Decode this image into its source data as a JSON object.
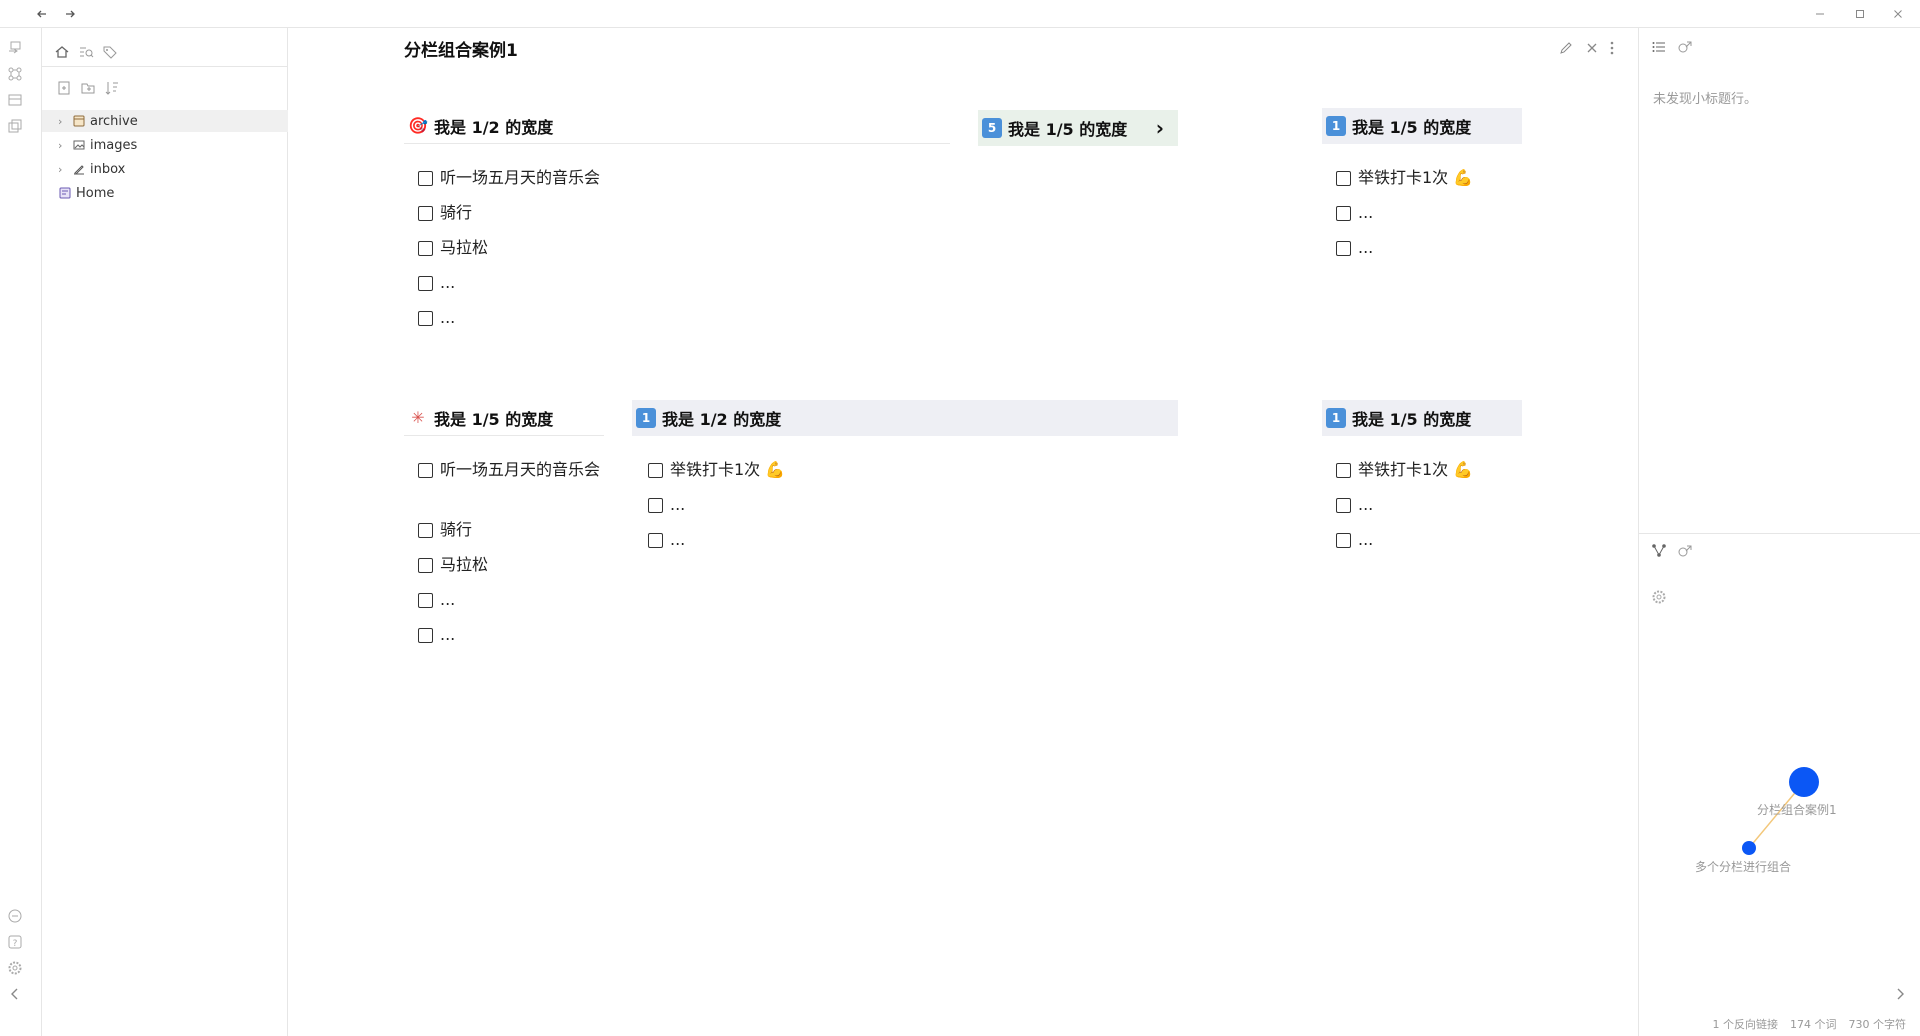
{
  "document": {
    "title": "分栏组合案例1"
  },
  "explorer": {
    "items": [
      {
        "label": "archive",
        "icon": "archive-folder-icon",
        "expandable": true
      },
      {
        "label": "images",
        "icon": "images-folder-icon",
        "expandable": true
      },
      {
        "label": "inbox",
        "icon": "inbox-folder-icon",
        "expandable": true
      },
      {
        "label": "Home",
        "icon": "home-note-icon",
        "expandable": false
      }
    ]
  },
  "row1": {
    "col1": {
      "heading": "我是 1/2 的宽度",
      "emoji": "🎯",
      "tasks": [
        "听一场五月天的音乐会",
        "骑行",
        "马拉松",
        "...",
        "..."
      ]
    },
    "col2": {
      "heading": "我是 1/5 的宽度",
      "emoji": "5",
      "arrow": "›"
    },
    "col3": {
      "heading": "我是 1/5 的宽度",
      "emoji": "1",
      "tasks": [
        "举铁打卡1次 💪",
        "...",
        "..."
      ]
    }
  },
  "row2": {
    "col1": {
      "heading": "我是 1/5 的宽度",
      "emoji": "✳",
      "tasks": [
        "听一场五月天的音乐会",
        "骑行",
        "马拉松",
        "...",
        "..."
      ]
    },
    "col2": {
      "heading": "我是 1/2 的宽度",
      "emoji": "1",
      "tasks": [
        "举铁打卡1次 💪",
        "...",
        "..."
      ]
    },
    "col3": {
      "heading": "我是 1/5 的宽度",
      "emoji": "1",
      "tasks": [
        "举铁打卡1次 💪",
        "...",
        "..."
      ]
    }
  },
  "outline": {
    "empty_text": "未发现小标题行。"
  },
  "graph": {
    "nodes": [
      {
        "label": "分栏组合案例1"
      },
      {
        "label": "多个分栏进行组合"
      }
    ],
    "colors": {
      "node": "#0b57f5",
      "edge": "#f3c77a"
    }
  },
  "status": {
    "backlinks": "1 个反向链接",
    "words": "174 个词",
    "chars": "730 个字符"
  }
}
